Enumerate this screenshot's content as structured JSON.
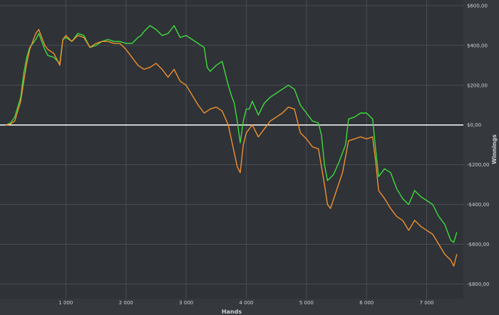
{
  "colors": {
    "background": "#35383d",
    "plot_background": "#2f3237",
    "grid": "#4a4e55",
    "zero_line": "#ffffff",
    "axis_text": "#d0d0d0",
    "green_series": "#3cdc3c",
    "orange_series": "#f0912e"
  },
  "chart_data": {
    "type": "line",
    "xlabel": "Hands",
    "ylabel": "Winnings",
    "xlim": [
      0,
      7550
    ],
    "ylim": [
      -820,
      600
    ],
    "x_ticks": [
      {
        "value": 1000,
        "label": "1 000"
      },
      {
        "value": 2000,
        "label": "2 000"
      },
      {
        "value": 3000,
        "label": "3 000"
      },
      {
        "value": 4000,
        "label": "4 000"
      },
      {
        "value": 5000,
        "label": "5 000"
      },
      {
        "value": 6000,
        "label": "6 000"
      },
      {
        "value": 7000,
        "label": "7 000"
      }
    ],
    "y_ticks": [
      {
        "value": 600,
        "label": "$600,00"
      },
      {
        "value": 400,
        "label": "$400,00"
      },
      {
        "value": 200,
        "label": "$200,00"
      },
      {
        "value": 0,
        "label": "$0,00"
      },
      {
        "value": -200,
        "label": "-$200,00"
      },
      {
        "value": -400,
        "label": "-$400,00"
      },
      {
        "value": -600,
        "label": "-$600,00"
      },
      {
        "value": -800,
        "label": "-$800,00"
      }
    ],
    "grid": true,
    "series": [
      {
        "color": "#3cdc3c",
        "points": [
          [
            0,
            0
          ],
          [
            80,
            10
          ],
          [
            150,
            40
          ],
          [
            250,
            140
          ],
          [
            300,
            260
          ],
          [
            350,
            340
          ],
          [
            400,
            390
          ],
          [
            450,
            410
          ],
          [
            500,
            430
          ],
          [
            550,
            460
          ],
          [
            600,
            420
          ],
          [
            650,
            380
          ],
          [
            700,
            350
          ],
          [
            800,
            340
          ],
          [
            900,
            310
          ],
          [
            950,
            430
          ],
          [
            1000,
            440
          ],
          [
            1100,
            420
          ],
          [
            1200,
            460
          ],
          [
            1300,
            450
          ],
          [
            1400,
            390
          ],
          [
            1500,
            400
          ],
          [
            1600,
            420
          ],
          [
            1700,
            430
          ],
          [
            1800,
            420
          ],
          [
            1900,
            420
          ],
          [
            2000,
            410
          ],
          [
            2100,
            410
          ],
          [
            2200,
            440
          ],
          [
            2250,
            450
          ],
          [
            2300,
            470
          ],
          [
            2400,
            500
          ],
          [
            2500,
            480
          ],
          [
            2600,
            450
          ],
          [
            2700,
            460
          ],
          [
            2800,
            500
          ],
          [
            2900,
            440
          ],
          [
            3000,
            450
          ],
          [
            3100,
            430
          ],
          [
            3200,
            410
          ],
          [
            3300,
            390
          ],
          [
            3350,
            290
          ],
          [
            3400,
            270
          ],
          [
            3500,
            300
          ],
          [
            3600,
            320
          ],
          [
            3700,
            200
          ],
          [
            3750,
            150
          ],
          [
            3800,
            110
          ],
          [
            3850,
            20
          ],
          [
            3900,
            -90
          ],
          [
            3950,
            20
          ],
          [
            4000,
            80
          ],
          [
            4050,
            80
          ],
          [
            4100,
            120
          ],
          [
            4200,
            50
          ],
          [
            4300,
            110
          ],
          [
            4400,
            140
          ],
          [
            4500,
            160
          ],
          [
            4600,
            180
          ],
          [
            4700,
            200
          ],
          [
            4800,
            180
          ],
          [
            4900,
            100
          ],
          [
            5000,
            60
          ],
          [
            5100,
            20
          ],
          [
            5200,
            10
          ],
          [
            5250,
            -50
          ],
          [
            5300,
            -200
          ],
          [
            5350,
            -280
          ],
          [
            5450,
            -250
          ],
          [
            5550,
            -180
          ],
          [
            5650,
            -100
          ],
          [
            5700,
            30
          ],
          [
            5800,
            40
          ],
          [
            5900,
            60
          ],
          [
            6000,
            60
          ],
          [
            6100,
            30
          ],
          [
            6150,
            -120
          ],
          [
            6200,
            -260
          ],
          [
            6300,
            -220
          ],
          [
            6400,
            -240
          ],
          [
            6500,
            -320
          ],
          [
            6600,
            -370
          ],
          [
            6700,
            -400
          ],
          [
            6800,
            -330
          ],
          [
            6900,
            -360
          ],
          [
            7000,
            -380
          ],
          [
            7100,
            -400
          ],
          [
            7200,
            -460
          ],
          [
            7300,
            -500
          ],
          [
            7400,
            -580
          ],
          [
            7450,
            -590
          ],
          [
            7500,
            -540
          ]
        ]
      },
      {
        "color": "#f0912e",
        "points": [
          [
            0,
            0
          ],
          [
            80,
            5
          ],
          [
            150,
            20
          ],
          [
            250,
            120
          ],
          [
            300,
            220
          ],
          [
            350,
            310
          ],
          [
            400,
            380
          ],
          [
            450,
            420
          ],
          [
            500,
            460
          ],
          [
            550,
            480
          ],
          [
            600,
            440
          ],
          [
            650,
            400
          ],
          [
            700,
            380
          ],
          [
            800,
            360
          ],
          [
            900,
            300
          ],
          [
            950,
            430
          ],
          [
            1000,
            450
          ],
          [
            1100,
            420
          ],
          [
            1200,
            450
          ],
          [
            1300,
            440
          ],
          [
            1400,
            390
          ],
          [
            1500,
            410
          ],
          [
            1600,
            420
          ],
          [
            1700,
            420
          ],
          [
            1800,
            410
          ],
          [
            1900,
            410
          ],
          [
            2000,
            380
          ],
          [
            2100,
            340
          ],
          [
            2200,
            300
          ],
          [
            2300,
            280
          ],
          [
            2400,
            290
          ],
          [
            2500,
            310
          ],
          [
            2600,
            280
          ],
          [
            2700,
            240
          ],
          [
            2800,
            280
          ],
          [
            2900,
            220
          ],
          [
            3000,
            200
          ],
          [
            3100,
            150
          ],
          [
            3200,
            100
          ],
          [
            3300,
            60
          ],
          [
            3400,
            80
          ],
          [
            3500,
            90
          ],
          [
            3600,
            70
          ],
          [
            3700,
            0
          ],
          [
            3800,
            -140
          ],
          [
            3850,
            -210
          ],
          [
            3900,
            -240
          ],
          [
            3950,
            -100
          ],
          [
            4000,
            -40
          ],
          [
            4100,
            0
          ],
          [
            4200,
            -60
          ],
          [
            4300,
            -20
          ],
          [
            4400,
            20
          ],
          [
            4500,
            40
          ],
          [
            4600,
            60
          ],
          [
            4700,
            90
          ],
          [
            4800,
            80
          ],
          [
            4900,
            -40
          ],
          [
            5000,
            -70
          ],
          [
            5100,
            -110
          ],
          [
            5200,
            -120
          ],
          [
            5300,
            -300
          ],
          [
            5350,
            -400
          ],
          [
            5400,
            -420
          ],
          [
            5500,
            -330
          ],
          [
            5600,
            -240
          ],
          [
            5700,
            -80
          ],
          [
            5800,
            -70
          ],
          [
            5900,
            -60
          ],
          [
            6000,
            -70
          ],
          [
            6100,
            -60
          ],
          [
            6150,
            -180
          ],
          [
            6200,
            -330
          ],
          [
            6300,
            -370
          ],
          [
            6400,
            -420
          ],
          [
            6500,
            -460
          ],
          [
            6600,
            -480
          ],
          [
            6700,
            -530
          ],
          [
            6800,
            -480
          ],
          [
            6900,
            -510
          ],
          [
            7000,
            -530
          ],
          [
            7100,
            -550
          ],
          [
            7200,
            -600
          ],
          [
            7300,
            -650
          ],
          [
            7400,
            -680
          ],
          [
            7450,
            -710
          ],
          [
            7500,
            -650
          ]
        ]
      }
    ]
  }
}
